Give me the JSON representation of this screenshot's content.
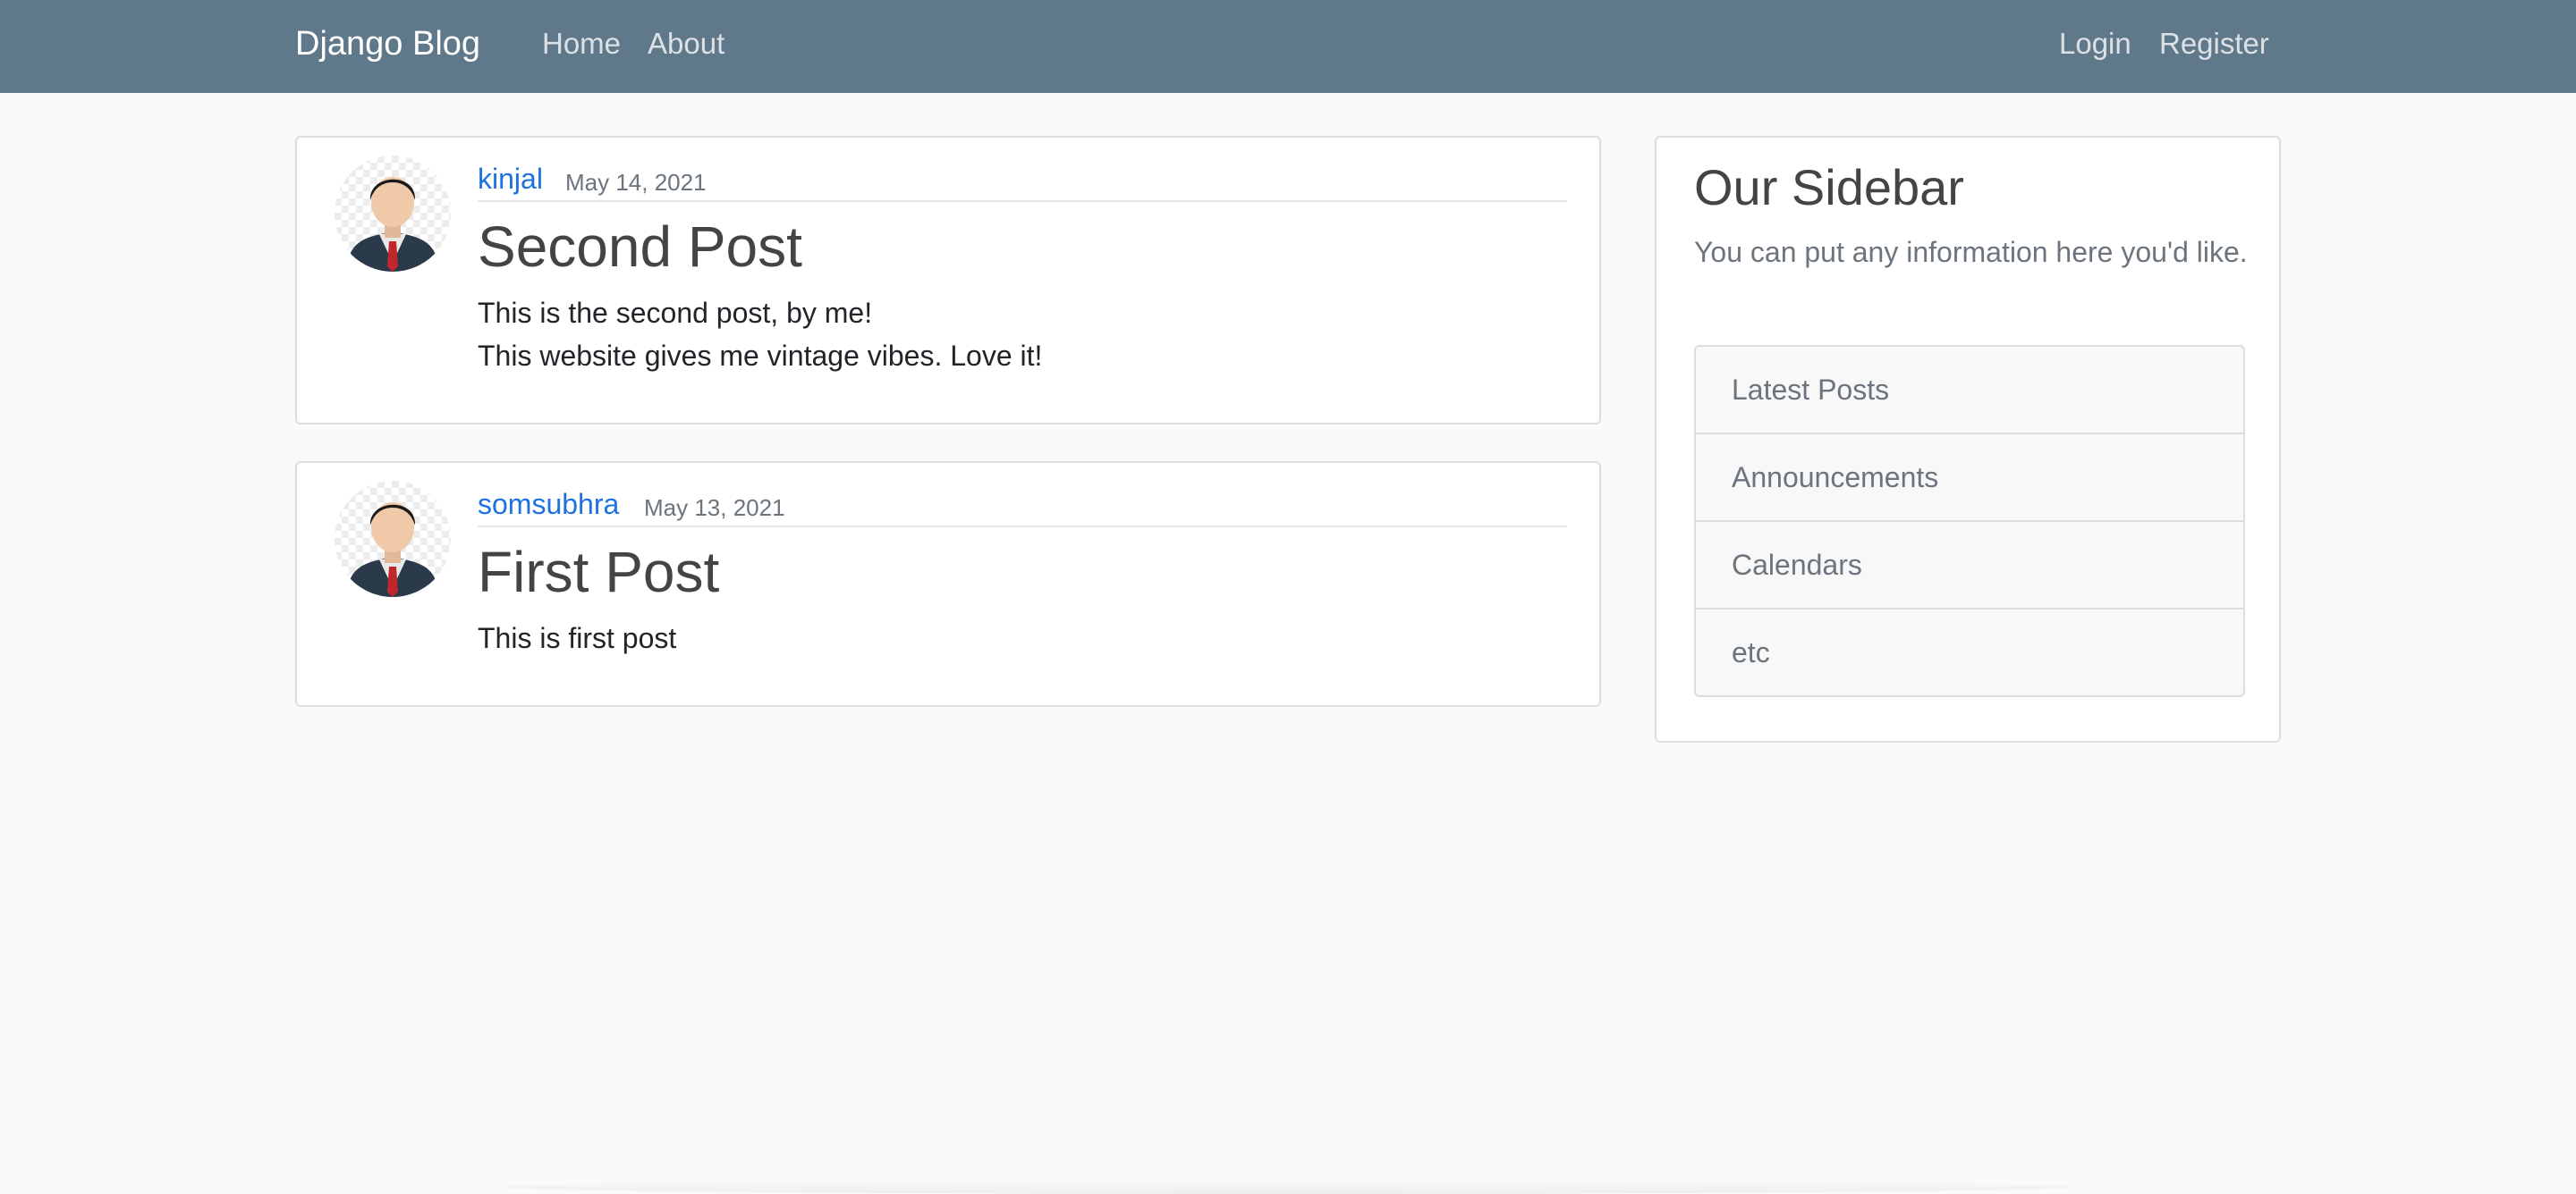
{
  "navbar": {
    "brand": "Django Blog",
    "links": {
      "home": "Home",
      "about": "About",
      "login": "Login",
      "register": "Register"
    },
    "background_color": "#5f788a"
  },
  "posts": [
    {
      "author": "kinjal",
      "date": "May 14, 2021",
      "title": "Second Post",
      "content_lines": [
        "This is the second post, by me!",
        "This website gives me vintage vibes. Love it!"
      ],
      "avatar_icon": "default-profile-avatar-icon"
    },
    {
      "author": "somsubhra",
      "date": "May 13, 2021",
      "title": "First Post",
      "content_lines": [
        "This is first post"
      ],
      "avatar_icon": "default-profile-avatar-icon"
    }
  ],
  "sidebar": {
    "title": "Our Sidebar",
    "description": "You can put any information here you'd like.",
    "items": [
      {
        "label": "Latest Posts"
      },
      {
        "label": "Announcements"
      },
      {
        "label": "Calendars"
      },
      {
        "label": "etc"
      }
    ]
  },
  "colors": {
    "link": "#1d72e0",
    "muted": "#6c757d",
    "heading": "#444444",
    "page_background": "#fafafa"
  }
}
